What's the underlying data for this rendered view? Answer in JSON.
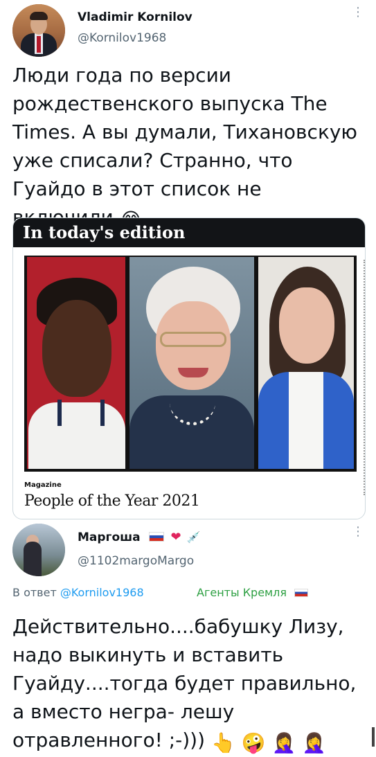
{
  "tweet1": {
    "author_name": "Vladimir Kornilov",
    "author_handle": "@Kornilov1968",
    "text": "Люди года по версии рождественского выпуска The Times. А вы думали, Тихановскую уже списали? Странно, что Гуайдо в этот список не включили",
    "text_emoji": "😂",
    "more_icon": "⋮",
    "card": {
      "banner": "In today's edition",
      "magazine_label": "Magazine",
      "magazine_title": "People of the Year 2021"
    }
  },
  "tweet2": {
    "author_name": "Маргоша",
    "name_emoji_heart": "❤",
    "name_emoji_syringe": "💉",
    "author_handle": "@1102margoMargo",
    "more_icon": "⋮",
    "reply_prefix": "В ответ",
    "reply_mention": "@Kornilov1968",
    "label": "Агенты Кремля",
    "text": "Действительно....бабушку Лизу, надо выкинуть и вставить Гуайду....тогда будет правильно, а вместо негра- лешу отравленного! ;-)))",
    "text_emojis": "👆 🤪 🤦‍♀️ 🤦‍♀️"
  }
}
